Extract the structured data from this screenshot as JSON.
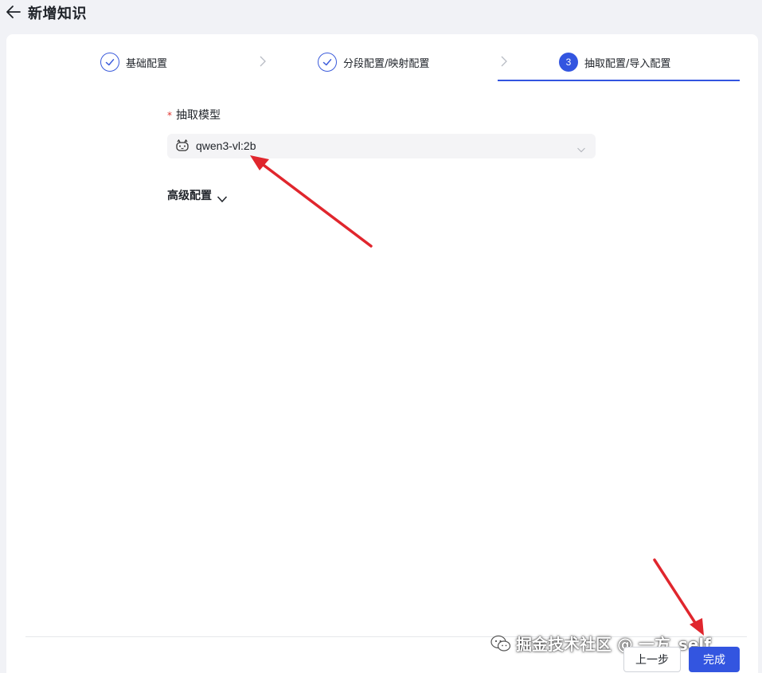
{
  "header": {
    "title": "新增知识",
    "back_icon": "arrow-left-icon"
  },
  "steps": [
    {
      "label": "基础配置",
      "status": "done",
      "icon": "check-icon"
    },
    {
      "label": "分段配置/映射配置",
      "status": "done",
      "icon": "check-icon"
    },
    {
      "label": "抽取配置/导入配置",
      "status": "active",
      "number": "3"
    }
  ],
  "form": {
    "model_field": {
      "required_mark": "*",
      "label": "抽取模型",
      "value": "qwen3-vl:2b",
      "icon": "ollama-model-icon"
    },
    "advanced": {
      "label": "高级配置",
      "icon": "chevron-down-icon"
    }
  },
  "footer": {
    "prev_label": "上一步",
    "finish_label": "完成"
  },
  "watermark": {
    "text": "掘金技术社区 @ 一方_self",
    "icon": "wechat-icon"
  },
  "colors": {
    "accent": "#3355e0",
    "annotation_arrow": "#e0262d",
    "required": "#e0342f",
    "background": "#f1f2f6"
  }
}
